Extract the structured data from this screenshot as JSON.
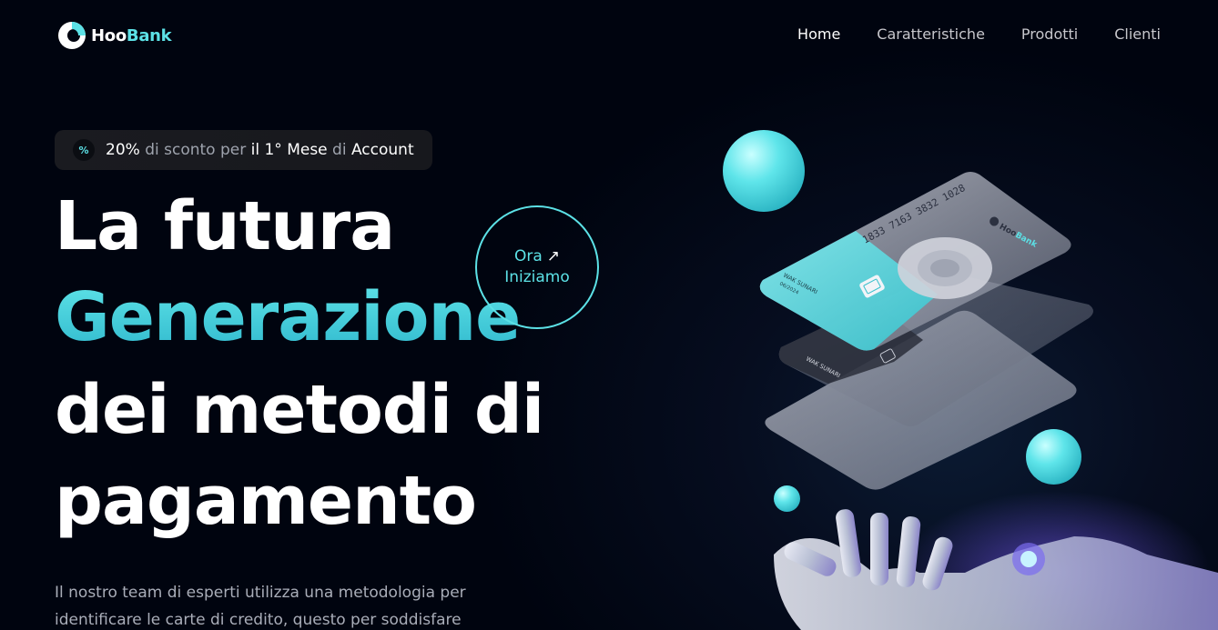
{
  "brand": {
    "name_part1": "Hoo",
    "name_part2": "Bank"
  },
  "nav": {
    "items": [
      {
        "label": "Home"
      },
      {
        "label": "Caratteristiche"
      },
      {
        "label": "Prodotti"
      },
      {
        "label": "Clienti"
      }
    ]
  },
  "promo": {
    "icon_glyph": "%",
    "part1": "20%",
    "part2": " di sconto per ",
    "part3": "il 1° Mese",
    "part4": " di ",
    "part5": "Account"
  },
  "hero": {
    "line1": "La futura",
    "line2": "Generazione",
    "line3": "dei metodi di",
    "line4": "pagamento",
    "description": "Il nostro team di esperti utilizza una metodologia per identificare le carte di credito, questo per soddisfare le tue esigenze. Esaminiamo"
  },
  "cta": {
    "line1": "Ora",
    "arrow": "↗",
    "line2": "Iniziamo"
  },
  "cards": {
    "card_number": "1833 7163 3832 1028",
    "holder": "WAK SUNARI",
    "expiry": "06/2024",
    "brand_part1": "Hoo",
    "brand_part2": "Bank"
  },
  "colors": {
    "accent": "#5ce1e6",
    "background": "#00040f"
  },
  "icons": {
    "logo": "hoobank-logo-icon",
    "promo": "percent-icon",
    "cta_arrow": "arrow-up-right-icon"
  }
}
